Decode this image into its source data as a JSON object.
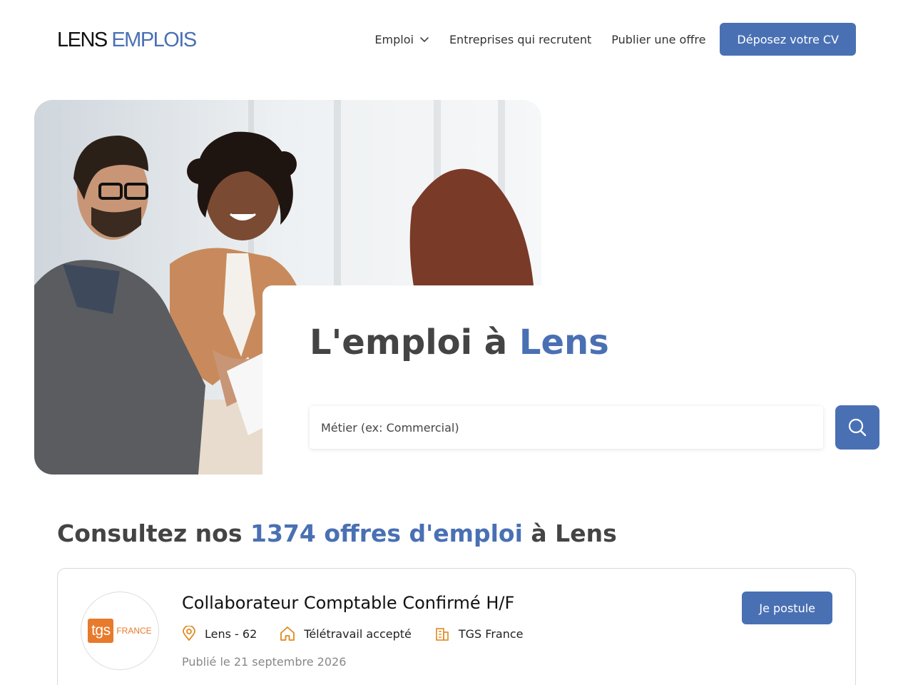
{
  "header": {
    "logo_part1": "LENS",
    "logo_part2": "EMPLOIS",
    "nav": {
      "emploi": "Emploi",
      "entreprises": "Entreprises qui recrutent",
      "publier": "Publier une offre",
      "cta": "Déposez votre CV"
    }
  },
  "hero": {
    "title_prefix": "L'emploi à ",
    "title_city": "Lens",
    "search_placeholder": "Métier (ex: Commercial)",
    "search_value": ""
  },
  "offers": {
    "prefix": "Consultez nos ",
    "highlight": "1374 offres d'emploi",
    "suffix": " à Lens"
  },
  "job": {
    "title": "Collaborateur Comptable Confirmé H/F",
    "location": "Lens - 62",
    "remote": "Télétravail accepté",
    "company": "TGS France",
    "date": "Publié le 21 septembre 2026",
    "apply_label": "Je postule",
    "logo_text": "tgs",
    "logo_suffix": "FRANCE"
  },
  "icons": {
    "nav_dropdown": "chevron-down-icon",
    "search": "search-icon",
    "location": "map-pin-icon",
    "remote": "home-icon",
    "company": "building-icon"
  },
  "colors": {
    "accent": "#4a70b4",
    "highlight": "#d2e8f7",
    "icon_orange": "#e08a1e",
    "tgs_orange": "#e87a2c"
  }
}
